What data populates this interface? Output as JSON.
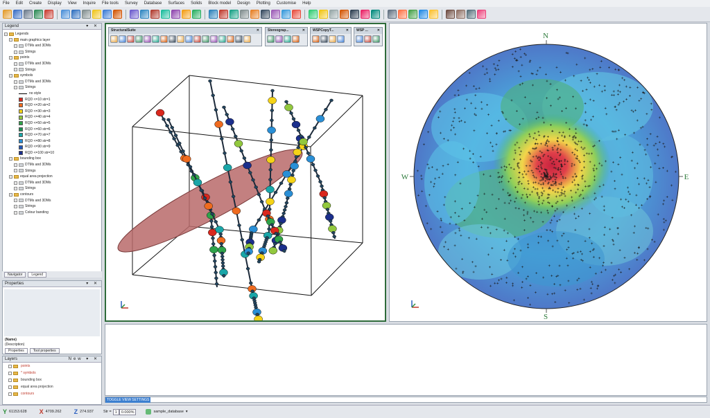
{
  "menu": [
    "File",
    "Edit",
    "Create",
    "Display",
    "View",
    "Inquire",
    "File tools",
    "Survey",
    "Database",
    "Surfaces",
    "Solids",
    "Block model",
    "Design",
    "Plotting",
    "Customise",
    "Help"
  ],
  "legend": {
    "title": "Legend",
    "tree": [
      {
        "label": "Legends",
        "indent": 0,
        "type": "folder"
      },
      {
        "label": "main graphics layer",
        "indent": 1,
        "type": "folder"
      },
      {
        "label": "DTMs and 3DMs",
        "indent": 2,
        "type": "folder"
      },
      {
        "label": "Strings",
        "indent": 2,
        "type": "folder"
      },
      {
        "label": "points",
        "indent": 1,
        "type": "folder"
      },
      {
        "label": "DTMs and 3DMs",
        "indent": 2,
        "type": "folder"
      },
      {
        "label": "Strings",
        "indent": 2,
        "type": "folder"
      },
      {
        "label": "symbols",
        "indent": 1,
        "type": "folder"
      },
      {
        "label": "DTMs and 3DMs",
        "indent": 2,
        "type": "folder"
      },
      {
        "label": "Strings",
        "indent": 2,
        "type": "folder"
      },
      {
        "label": "no style",
        "indent": 3,
        "type": "line"
      },
      {
        "label": "RQD <=10 str=1",
        "indent": 3,
        "type": "swatch",
        "color": "#d9271d"
      },
      {
        "label": "RQD <=20 str=2",
        "indent": 3,
        "type": "swatch",
        "color": "#ef6b1f"
      },
      {
        "label": "RQD <=30 str=3",
        "indent": 3,
        "type": "swatch",
        "color": "#f5d317"
      },
      {
        "label": "RQD <=40 str=4",
        "indent": 3,
        "type": "swatch",
        "color": "#92c83e"
      },
      {
        "label": "RQD <=50 str=5",
        "indent": 3,
        "type": "swatch",
        "color": "#2fa34a"
      },
      {
        "label": "RQD <=60 str=6",
        "indent": 3,
        "type": "swatch",
        "color": "#1d8f52"
      },
      {
        "label": "RQD <=70 str=7",
        "indent": 3,
        "type": "swatch",
        "color": "#1aa6a8"
      },
      {
        "label": "RQD <=80 str=8",
        "indent": 3,
        "type": "swatch",
        "color": "#2a8fd6"
      },
      {
        "label": "RQD <=90 str=9",
        "indent": 3,
        "type": "swatch",
        "color": "#2156b8"
      },
      {
        "label": "RQD <=100 str=10",
        "indent": 3,
        "type": "swatch",
        "color": "#1b2f8c"
      },
      {
        "label": "bounding box",
        "indent": 1,
        "type": "folder"
      },
      {
        "label": "DTMs and 3DMs",
        "indent": 2,
        "type": "folder"
      },
      {
        "label": "Strings",
        "indent": 2,
        "type": "folder"
      },
      {
        "label": "equal area projection",
        "indent": 1,
        "type": "folder"
      },
      {
        "label": "DTMs and 3DMs",
        "indent": 2,
        "type": "folder"
      },
      {
        "label": "Strings",
        "indent": 2,
        "type": "folder"
      },
      {
        "label": "contours",
        "indent": 1,
        "type": "folder"
      },
      {
        "label": "DTMs and 3DMs",
        "indent": 2,
        "type": "folder"
      },
      {
        "label": "Strings",
        "indent": 2,
        "type": "folder"
      },
      {
        "label": "Colour banding",
        "indent": 2,
        "type": "folder"
      }
    ],
    "tabs": [
      "Navigator",
      "Legend"
    ]
  },
  "properties": {
    "title": "Properties",
    "name": "(Name)",
    "description": "(Description)",
    "tabs": [
      "Properties",
      "Tool properties"
    ]
  },
  "layers": {
    "title": "Layers",
    "new_label": "New",
    "items": [
      {
        "label": "points",
        "color": "#c0392b"
      },
      {
        "label": "* symbols",
        "color": "#c0392b"
      },
      {
        "label": "bounding box",
        "color": "#333"
      },
      {
        "label": "equal area projection",
        "color": "#333"
      },
      {
        "label": "contours",
        "color": "#c0392b"
      }
    ]
  },
  "tool_toolbars": [
    {
      "title": "StructuralSuite"
    },
    {
      "title": "Stereograp..."
    },
    {
      "title": "WSPCopyT..."
    },
    {
      "title": "WSP ..."
    }
  ],
  "stereonet": {
    "n": "N",
    "s": "S",
    "e": "E",
    "w": "W"
  },
  "toggle_label": "TOGGLE VIEW SETTINGS",
  "status": {
    "y": "61153.628",
    "x": "4709.262",
    "z": "274.937",
    "str_label": "Str =",
    "str_value": "1",
    "zoom": "0.000%",
    "database": "sample_database"
  }
}
